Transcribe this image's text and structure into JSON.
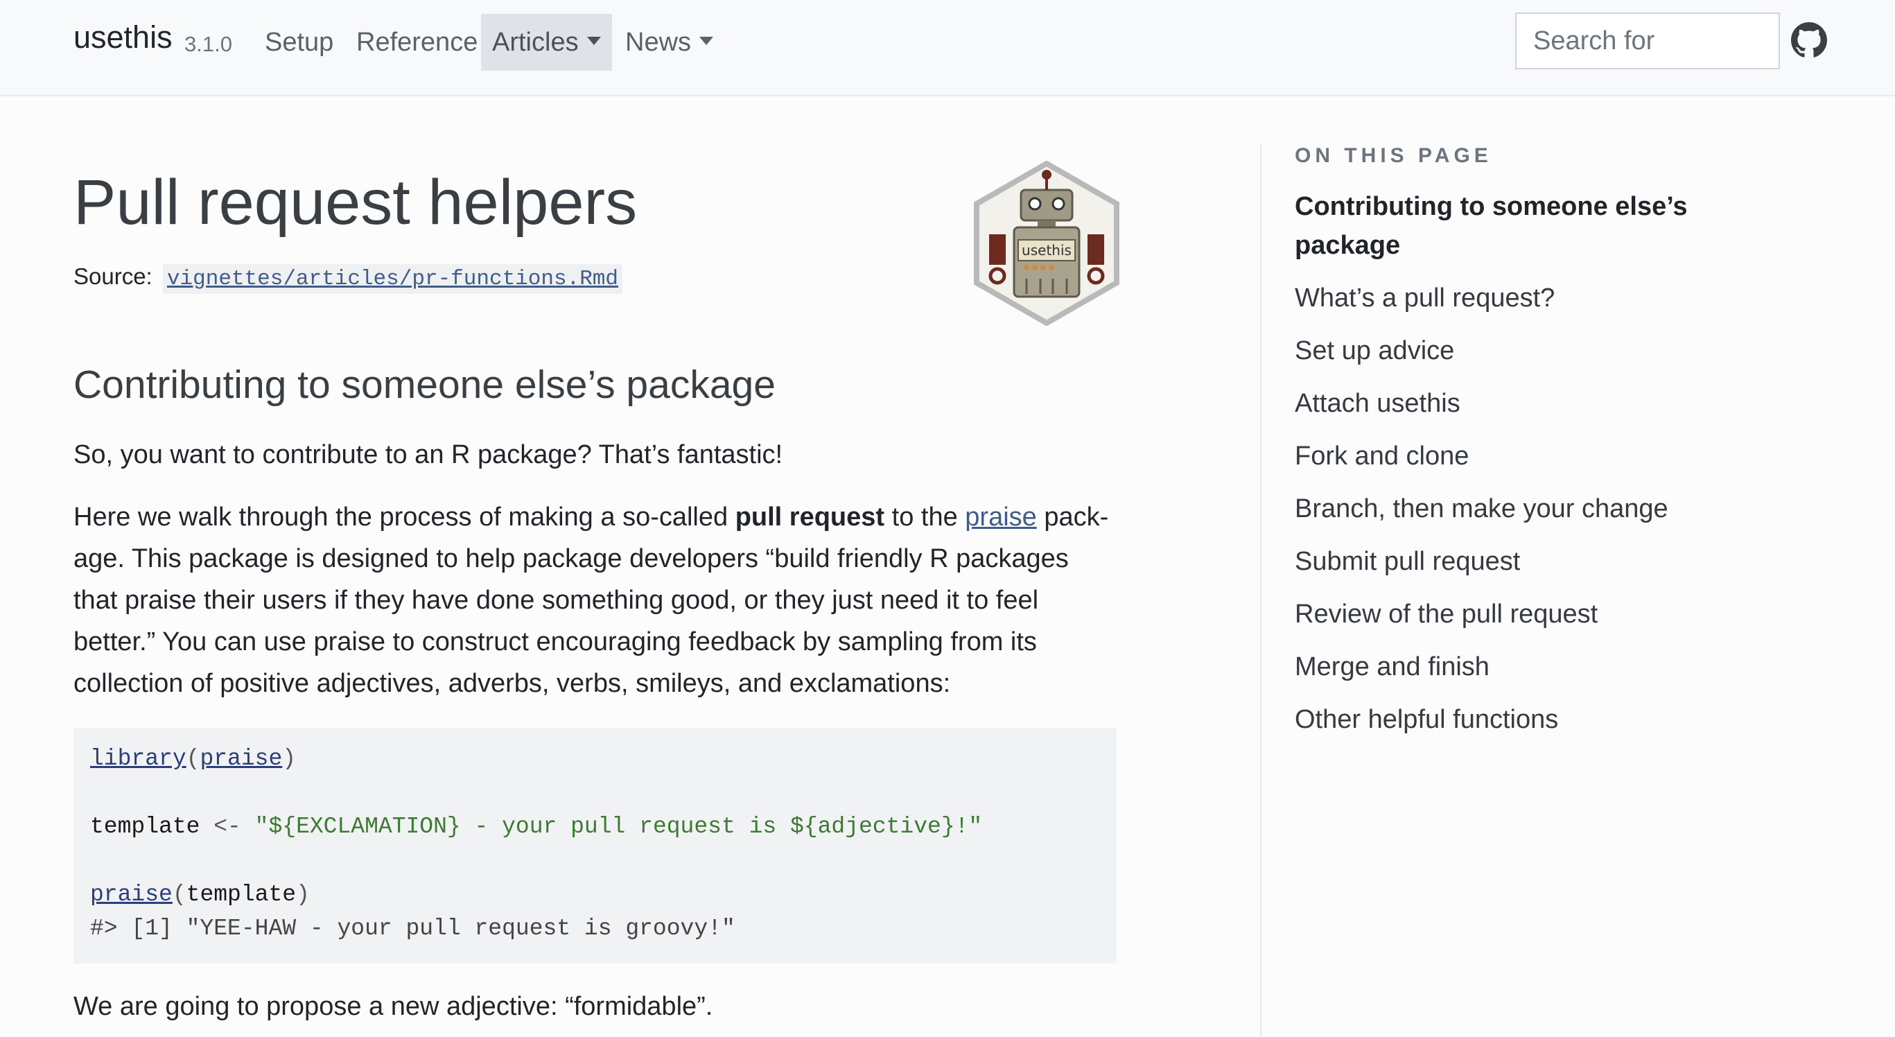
{
  "navbar": {
    "brand": "usethis",
    "version": "3.1.0",
    "items": [
      {
        "label": "Setup"
      },
      {
        "label": "Reference"
      },
      {
        "label": "Articles"
      },
      {
        "label": "News"
      }
    ],
    "search_placeholder": "Search for",
    "github_icon": "github-icon"
  },
  "article": {
    "title": "Pull request helpers",
    "source_label": "Source:",
    "source_path": "vignettes/articles/pr-functions.Rmd",
    "logo_text": "usethis",
    "section_heading": "Contributing to someone else’s package",
    "p1": "So, you want to contribute to an R package? That’s fantastic!",
    "p2_before_bold": "Here we walk through the process of making a so-called ",
    "p2_bold": "pull request",
    "p2_mid": " to the ",
    "p2_link": "praise",
    "p2_after": " pack­age. This package is designed to help package developers “build friendly R packages that praise their users if they have done something good, or they just need it to feel better.” You can use praise to construct encouraging feedback by sampling from its collection of posi­tive adjectives, adverbs, verbs, smileys, and exclamations:",
    "code": {
      "l1_fn": "library",
      "l1_arg": "praise",
      "l2_var": "template",
      "l2_op": " <- ",
      "l2_str": "\"${EXCLAMATION} - your pull request is ${adjective}!\"",
      "l3_fn": "praise",
      "l3_arg": "template",
      "l4_out": "#> [1] \"YEE-HAW - your pull request is groovy!\""
    },
    "p3": "We are going to propose a new adjective: “formidable”."
  },
  "toc": {
    "title": "ON THIS PAGE",
    "items": [
      {
        "label": "Contributing to someone else’s package",
        "active": true
      },
      {
        "label": "What’s a pull request?"
      },
      {
        "label": "Set up advice"
      },
      {
        "label": "Attach usethis"
      },
      {
        "label": "Fork and clone"
      },
      {
        "label": "Branch, then make your change"
      },
      {
        "label": "Submit pull request"
      },
      {
        "label": "Review of the pull request"
      },
      {
        "label": "Merge and finish"
      },
      {
        "label": "Other helpful functions"
      }
    ]
  }
}
